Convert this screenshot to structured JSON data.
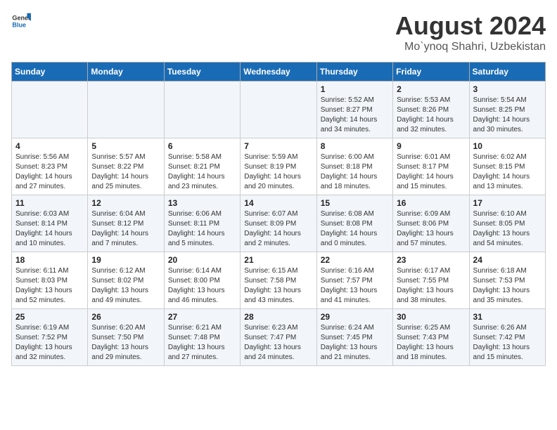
{
  "header": {
    "logo_general": "General",
    "logo_blue": "Blue",
    "title": "August 2024",
    "subtitle": "Mo`ynoq Shahri, Uzbekistan"
  },
  "calendar": {
    "days_of_week": [
      "Sunday",
      "Monday",
      "Tuesday",
      "Wednesday",
      "Thursday",
      "Friday",
      "Saturday"
    ],
    "weeks": [
      [
        {
          "day": "",
          "info": ""
        },
        {
          "day": "",
          "info": ""
        },
        {
          "day": "",
          "info": ""
        },
        {
          "day": "",
          "info": ""
        },
        {
          "day": "1",
          "info": "Sunrise: 5:52 AM\nSunset: 8:27 PM\nDaylight: 14 hours\nand 34 minutes."
        },
        {
          "day": "2",
          "info": "Sunrise: 5:53 AM\nSunset: 8:26 PM\nDaylight: 14 hours\nand 32 minutes."
        },
        {
          "day": "3",
          "info": "Sunrise: 5:54 AM\nSunset: 8:25 PM\nDaylight: 14 hours\nand 30 minutes."
        }
      ],
      [
        {
          "day": "4",
          "info": "Sunrise: 5:56 AM\nSunset: 8:23 PM\nDaylight: 14 hours\nand 27 minutes."
        },
        {
          "day": "5",
          "info": "Sunrise: 5:57 AM\nSunset: 8:22 PM\nDaylight: 14 hours\nand 25 minutes."
        },
        {
          "day": "6",
          "info": "Sunrise: 5:58 AM\nSunset: 8:21 PM\nDaylight: 14 hours\nand 23 minutes."
        },
        {
          "day": "7",
          "info": "Sunrise: 5:59 AM\nSunset: 8:19 PM\nDaylight: 14 hours\nand 20 minutes."
        },
        {
          "day": "8",
          "info": "Sunrise: 6:00 AM\nSunset: 8:18 PM\nDaylight: 14 hours\nand 18 minutes."
        },
        {
          "day": "9",
          "info": "Sunrise: 6:01 AM\nSunset: 8:17 PM\nDaylight: 14 hours\nand 15 minutes."
        },
        {
          "day": "10",
          "info": "Sunrise: 6:02 AM\nSunset: 8:15 PM\nDaylight: 14 hours\nand 13 minutes."
        }
      ],
      [
        {
          "day": "11",
          "info": "Sunrise: 6:03 AM\nSunset: 8:14 PM\nDaylight: 14 hours\nand 10 minutes."
        },
        {
          "day": "12",
          "info": "Sunrise: 6:04 AM\nSunset: 8:12 PM\nDaylight: 14 hours\nand 7 minutes."
        },
        {
          "day": "13",
          "info": "Sunrise: 6:06 AM\nSunset: 8:11 PM\nDaylight: 14 hours\nand 5 minutes."
        },
        {
          "day": "14",
          "info": "Sunrise: 6:07 AM\nSunset: 8:09 PM\nDaylight: 14 hours\nand 2 minutes."
        },
        {
          "day": "15",
          "info": "Sunrise: 6:08 AM\nSunset: 8:08 PM\nDaylight: 14 hours\nand 0 minutes."
        },
        {
          "day": "16",
          "info": "Sunrise: 6:09 AM\nSunset: 8:06 PM\nDaylight: 13 hours\nand 57 minutes."
        },
        {
          "day": "17",
          "info": "Sunrise: 6:10 AM\nSunset: 8:05 PM\nDaylight: 13 hours\nand 54 minutes."
        }
      ],
      [
        {
          "day": "18",
          "info": "Sunrise: 6:11 AM\nSunset: 8:03 PM\nDaylight: 13 hours\nand 52 minutes."
        },
        {
          "day": "19",
          "info": "Sunrise: 6:12 AM\nSunset: 8:02 PM\nDaylight: 13 hours\nand 49 minutes."
        },
        {
          "day": "20",
          "info": "Sunrise: 6:14 AM\nSunset: 8:00 PM\nDaylight: 13 hours\nand 46 minutes."
        },
        {
          "day": "21",
          "info": "Sunrise: 6:15 AM\nSunset: 7:58 PM\nDaylight: 13 hours\nand 43 minutes."
        },
        {
          "day": "22",
          "info": "Sunrise: 6:16 AM\nSunset: 7:57 PM\nDaylight: 13 hours\nand 41 minutes."
        },
        {
          "day": "23",
          "info": "Sunrise: 6:17 AM\nSunset: 7:55 PM\nDaylight: 13 hours\nand 38 minutes."
        },
        {
          "day": "24",
          "info": "Sunrise: 6:18 AM\nSunset: 7:53 PM\nDaylight: 13 hours\nand 35 minutes."
        }
      ],
      [
        {
          "day": "25",
          "info": "Sunrise: 6:19 AM\nSunset: 7:52 PM\nDaylight: 13 hours\nand 32 minutes."
        },
        {
          "day": "26",
          "info": "Sunrise: 6:20 AM\nSunset: 7:50 PM\nDaylight: 13 hours\nand 29 minutes."
        },
        {
          "day": "27",
          "info": "Sunrise: 6:21 AM\nSunset: 7:48 PM\nDaylight: 13 hours\nand 27 minutes."
        },
        {
          "day": "28",
          "info": "Sunrise: 6:23 AM\nSunset: 7:47 PM\nDaylight: 13 hours\nand 24 minutes."
        },
        {
          "day": "29",
          "info": "Sunrise: 6:24 AM\nSunset: 7:45 PM\nDaylight: 13 hours\nand 21 minutes."
        },
        {
          "day": "30",
          "info": "Sunrise: 6:25 AM\nSunset: 7:43 PM\nDaylight: 13 hours\nand 18 minutes."
        },
        {
          "day": "31",
          "info": "Sunrise: 6:26 AM\nSunset: 7:42 PM\nDaylight: 13 hours\nand 15 minutes."
        }
      ]
    ]
  }
}
